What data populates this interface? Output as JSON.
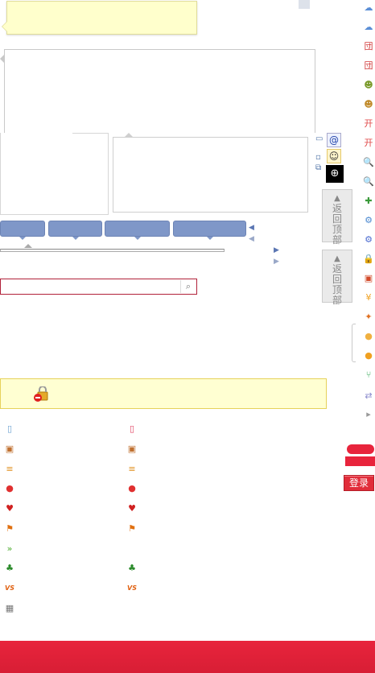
{
  "back_to_top_label": "返回顶部",
  "login_label": "登录",
  "search": {
    "placeholder": ""
  },
  "side_icons": [
    {
      "name": "cloud-blue-icon",
      "glyph": "☁",
      "color": "#5a8ed6"
    },
    {
      "name": "cloud-blue-2-icon",
      "glyph": "☁",
      "color": "#5a8ed6"
    },
    {
      "name": "red-box-icon",
      "glyph": "団",
      "color": "#d23a3a"
    },
    {
      "name": "red-box-2-icon",
      "glyph": "団",
      "color": "#d23a3a"
    },
    {
      "name": "robot-face-icon",
      "glyph": "☻",
      "color": "#7a9a2a"
    },
    {
      "name": "robot-face-2-icon",
      "glyph": "☻",
      "color": "#c08a2a"
    },
    {
      "name": "kai-icon",
      "glyph": "开",
      "color": "#e04848"
    },
    {
      "name": "kai-2-icon",
      "glyph": "开",
      "color": "#e04848"
    },
    {
      "name": "magnifier-icon",
      "glyph": "🔍",
      "color": "#666"
    },
    {
      "name": "magnifier-2-icon",
      "glyph": "🔍",
      "color": "#666"
    },
    {
      "name": "add-user-icon",
      "glyph": "✚",
      "color": "#3a9a3a"
    },
    {
      "name": "gear-icon",
      "glyph": "⚙",
      "color": "#4a88d0"
    },
    {
      "name": "gear-2-icon",
      "glyph": "⚙",
      "color": "#4a6ad0"
    },
    {
      "name": "lock-icon",
      "glyph": "🔒",
      "color": "#d6a020"
    },
    {
      "name": "windows-icon",
      "glyph": "▣",
      "color": "#d24a2a"
    },
    {
      "name": "coin-icon",
      "glyph": "¥",
      "color": "#f0a020"
    },
    {
      "name": "gift-icon",
      "glyph": "✦",
      "color": "#e07020"
    },
    {
      "name": "chick-icon",
      "glyph": "●",
      "color": "#f0b040"
    },
    {
      "name": "chick-2-icon",
      "glyph": "●",
      "color": "#f0a020"
    },
    {
      "name": "branch-icon",
      "glyph": "⑂",
      "color": "#3aaa5a"
    },
    {
      "name": "transfer-icon",
      "glyph": "⇄",
      "color": "#8888cc"
    },
    {
      "name": "small-arrow-icon",
      "glyph": "▸",
      "color": "#999"
    }
  ],
  "list_left": [
    {
      "name": "phone-icon",
      "glyph": "▯",
      "color": "#6aa0d0"
    },
    {
      "name": "photo-frame-icon",
      "glyph": "▣",
      "color": "#c07030"
    },
    {
      "name": "bars-icon",
      "glyph": "≡",
      "color": "#e09020"
    },
    {
      "name": "circle-logo-icon",
      "glyph": "●",
      "color": "#e03030"
    },
    {
      "name": "cards-icon",
      "glyph": "♥",
      "color": "#d02020"
    },
    {
      "name": "flag-icon",
      "glyph": "⚑",
      "color": "#e07010"
    },
    {
      "name": "forward-icon",
      "glyph": "»",
      "color": "#4aaa2a"
    },
    {
      "name": "clover-icon",
      "glyph": "♣",
      "color": "#2a8a2a"
    },
    {
      "name": "vs-icon",
      "glyph": "VS",
      "color": "#e06010"
    },
    {
      "name": "film-icon",
      "glyph": "▦",
      "color": "#777"
    }
  ],
  "list_right": [
    {
      "name": "phone-icon",
      "glyph": "▯",
      "color": "#e04060"
    },
    {
      "name": "photo-frame-icon",
      "glyph": "▣",
      "color": "#c07030"
    },
    {
      "name": "bars-icon",
      "glyph": "≡",
      "color": "#e09020"
    },
    {
      "name": "circle-logo-icon",
      "glyph": "●",
      "color": "#e03030"
    },
    {
      "name": "cards-icon",
      "glyph": "♥",
      "color": "#d02020"
    },
    {
      "name": "flag-icon",
      "glyph": "⚑",
      "color": "#e07010"
    },
    {
      "name": "clover-icon",
      "glyph": "♣",
      "color": "#2a8a2a"
    },
    {
      "name": "vs-icon",
      "glyph": "VS",
      "color": "#e06010"
    }
  ],
  "colors": {
    "brand_red": "#e8243c",
    "tab_blue": "#7f97c8",
    "notice_bg": "#ffffd2"
  }
}
